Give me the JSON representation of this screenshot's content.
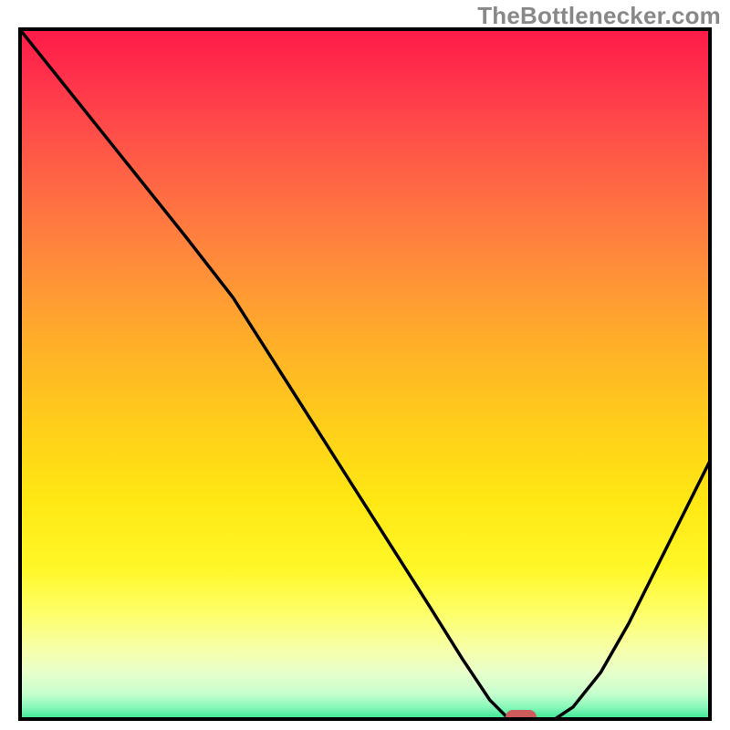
{
  "watermark_text": "TheBottlenecker.com",
  "chart_data": {
    "type": "line",
    "title": "",
    "xlabel": "",
    "ylabel": "",
    "xlim": [
      0,
      100
    ],
    "ylim": [
      0,
      100
    ],
    "x": [
      0,
      8,
      16,
      24,
      31,
      38,
      45,
      52,
      59,
      64,
      68,
      71,
      74,
      77,
      80,
      84,
      88,
      92,
      96,
      100
    ],
    "values": [
      100,
      90,
      80,
      70,
      61,
      50,
      39,
      28,
      17,
      9,
      3,
      0,
      0,
      0,
      2,
      7,
      14,
      22,
      30,
      38
    ],
    "marker": {
      "x": 72.5,
      "y": 0
    },
    "background": "heatmap-gradient-red-to-green"
  }
}
